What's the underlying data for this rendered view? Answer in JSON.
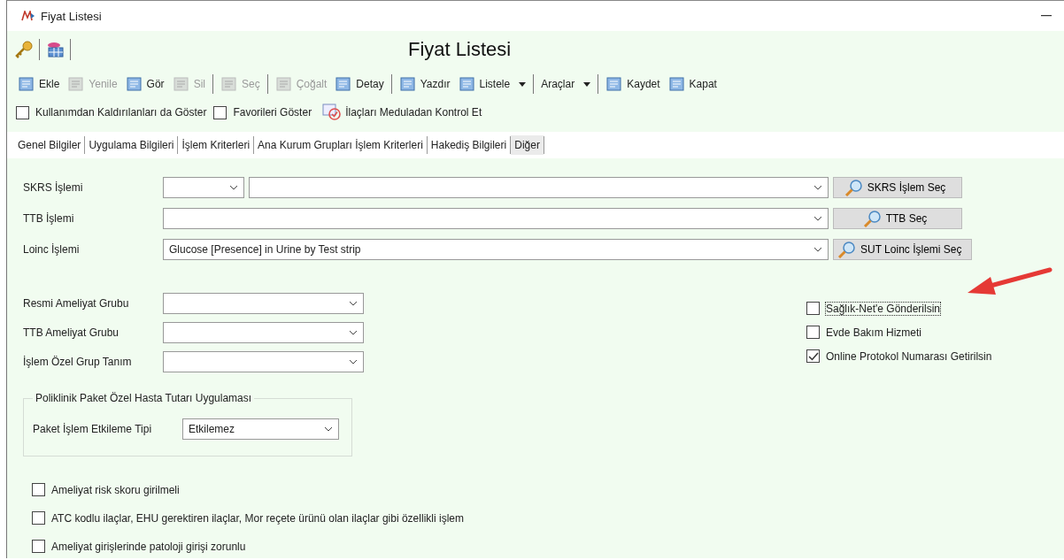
{
  "window": {
    "title": "Fiyat Listesi"
  },
  "header": {
    "title": "Fiyat Listesi"
  },
  "toolbar": [
    {
      "label": "Ekle",
      "kind": "button",
      "disabled": false,
      "separator_after": false
    },
    {
      "label": "Yenile",
      "kind": "button",
      "disabled": true,
      "separator_after": false
    },
    {
      "label": "Gör",
      "kind": "button",
      "disabled": false,
      "separator_after": false
    },
    {
      "label": "Sil",
      "kind": "button",
      "disabled": true,
      "separator_after": true
    },
    {
      "label": "Seç",
      "kind": "button",
      "disabled": true,
      "separator_after": true
    },
    {
      "label": "Çoğalt",
      "kind": "button",
      "disabled": true,
      "separator_after": false
    },
    {
      "label": "Detay",
      "kind": "button",
      "disabled": false,
      "separator_after": true
    },
    {
      "label": "Yazdır",
      "kind": "button",
      "disabled": false,
      "separator_after": false
    },
    {
      "label": "Listele",
      "kind": "dropdown",
      "disabled": false,
      "separator_after": true
    },
    {
      "label": "Araçlar",
      "kind": "menu",
      "disabled": false,
      "separator_after": true
    },
    {
      "label": "Kaydet",
      "kind": "button",
      "disabled": false,
      "separator_after": false
    },
    {
      "label": "Kapat",
      "kind": "button",
      "disabled": false,
      "separator_after": false
    }
  ],
  "filters": [
    {
      "kind": "checkbox",
      "label": "Kullanımdan Kaldırılanları da Göster",
      "checked": false
    },
    {
      "kind": "checkbox",
      "label": "Favorileri Göster",
      "checked": false
    },
    {
      "kind": "action",
      "label": "İlaçları Meduladan Kontrol Et"
    }
  ],
  "tabs": [
    {
      "label": "Genel Bilgiler",
      "selected": false
    },
    {
      "label": "Uygulama Bilgileri",
      "selected": false
    },
    {
      "label": "İşlem Kriterleri",
      "selected": false
    },
    {
      "label": "Ana Kurum Grupları İşlem Kriterleri",
      "selected": false
    },
    {
      "label": "Hakediş Bilgileri",
      "selected": false
    },
    {
      "label": "Diğer",
      "selected": true
    }
  ],
  "lookups": [
    {
      "kind": "split",
      "label": "SKRS İşlemi",
      "button": "SKRS İşlem Seç"
    },
    {
      "kind": "single",
      "label": "TTB İşlemi",
      "button": "TTB Seç"
    },
    {
      "kind": "single",
      "label": "Loinc İşlemi",
      "value": "Glucose [Presence] in Urine by Test strip",
      "button": "SUT Loinc İşlemi Seç"
    }
  ],
  "groups": [
    {
      "label": "Resmi Ameliyat Grubu"
    },
    {
      "label": "TTB Ameliyat Grubu"
    },
    {
      "label": "İşlem Özel Grup Tanım"
    }
  ],
  "options": [
    {
      "label": "Sağlık-Net'e Gönderilsin",
      "checked": false,
      "focused": true
    },
    {
      "label": "Evde Bakım Hizmeti",
      "checked": false,
      "focused": false
    },
    {
      "label": "Online Protokol Numarası Getirilsin",
      "checked": true,
      "focused": false
    }
  ],
  "package_box": {
    "title": "Poliklinik Paket Özel Hasta Tutarı Uygulaması",
    "label": "Paket İşlem Etkileme Tipi",
    "value": "Etkilemez"
  },
  "flags": [
    {
      "label": "Ameliyat risk skoru girilmeli",
      "checked": false
    },
    {
      "label": "ATC kodlu ilaçlar, EHU gerektiren ilaçlar, Mor reçete ürünü olan ilaçlar gibi özellikli işlem",
      "checked": false
    },
    {
      "label": "Ameliyat girişlerinde patoloji girişi zorunlu",
      "checked": false
    }
  ]
}
